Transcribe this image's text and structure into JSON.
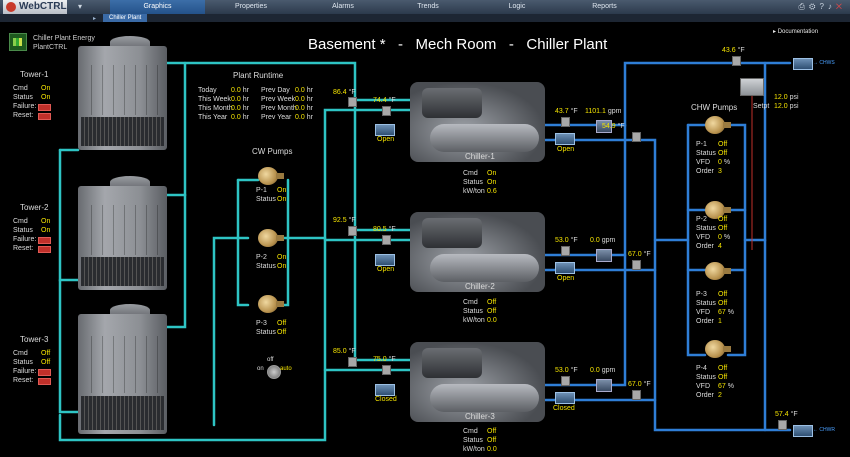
{
  "app": {
    "logo": "WebCTRL"
  },
  "nav": {
    "items": [
      {
        "label": "Graphics",
        "active": true
      },
      {
        "label": "Properties",
        "active": false
      },
      {
        "label": "Alarms",
        "active": false
      },
      {
        "label": "Trends",
        "active": false
      },
      {
        "label": "Logic",
        "active": false
      },
      {
        "label": "Reports",
        "active": false
      }
    ],
    "breadcrumb": "Chiller Plant"
  },
  "header": {
    "title": "Basement *   -   Mech Room   -   Chiller Plant",
    "documentation": "Documentation",
    "plant_energy": [
      "Chiller Plant Energy",
      "PlantCTRL"
    ]
  },
  "runtime": {
    "title": "Plant Runtime",
    "rows": [
      {
        "l1": "Today",
        "v1": "0.0",
        "l2": "Prev Day",
        "v2": "0.0"
      },
      {
        "l1": "This Week",
        "v1": "0.0",
        "l2": "Prev Week",
        "v2": "0.0"
      },
      {
        "l1": "This Month",
        "v1": "0.0",
        "l2": "Prev Month",
        "v2": "0.0"
      },
      {
        "l1": "This Year",
        "v1": "0.0",
        "l2": "Prev Year",
        "v2": "0.0"
      }
    ],
    "unit": "hr"
  },
  "towers": [
    {
      "name": "Tower-1",
      "cmd": "On",
      "status": "On"
    },
    {
      "name": "Tower-2",
      "cmd": "On",
      "status": "On"
    },
    {
      "name": "Tower-3",
      "cmd": "Off",
      "status": "Off"
    }
  ],
  "tower_labels": {
    "cmd": "Cmd",
    "status": "Status",
    "failure": "Failure:",
    "reset": "Reset:"
  },
  "cw_pumps": {
    "title": "CW Pumps",
    "items": [
      {
        "name": "P-1",
        "cmd": "On",
        "status": "On"
      },
      {
        "name": "P-2",
        "cmd": "On",
        "status": "On"
      },
      {
        "name": "P-3",
        "cmd": "Off",
        "status": "Off"
      }
    ]
  },
  "chillers": [
    {
      "name": "Chiller-1",
      "cmd": "On",
      "status": "On",
      "kwton": "0.6",
      "cw_ret": "86.4",
      "cw_sup": "74.4",
      "valve": "Open",
      "chw_ret": "43.7",
      "flow": "1101.1",
      "chw_sup": "54.9",
      "out_valve": "Open"
    },
    {
      "name": "Chiller-2",
      "cmd": "Off",
      "status": "Off",
      "kwton": "0.0",
      "cw_ret": "92.5",
      "cw_sup": "80.5",
      "valve": "Open",
      "chw_ret": "53.0",
      "flow": "0.0",
      "chw_sup": "67.0",
      "out_valve": "Open"
    },
    {
      "name": "Chiller-3",
      "cmd": "Off",
      "status": "Off",
      "kwton": "0.0",
      "cw_ret": "85.0",
      "cw_sup": "75.0",
      "valve": "Closed",
      "chw_ret": "53.0",
      "flow": "0.0",
      "chw_sup": "67.0",
      "out_valve": "Closed"
    }
  ],
  "chiller_labels": {
    "cmd": "Cmd",
    "status": "Status",
    "kwton": "kW/ton",
    "deg": "°F",
    "gpm": "gpm"
  },
  "chw_pumps": {
    "title": "CHW Pumps",
    "items": [
      {
        "name": "P-1",
        "cmd": "Off",
        "status": "Off",
        "vfd": "0",
        "order": "3"
      },
      {
        "name": "P-2",
        "cmd": "Off",
        "status": "Off",
        "vfd": "0",
        "order": "4"
      },
      {
        "name": "P-3",
        "cmd": "Off",
        "status": "Off",
        "vfd": "67",
        "order": "1"
      },
      {
        "name": "P-4",
        "cmd": "Off",
        "status": "Off",
        "vfd": "67",
        "order": "2"
      }
    ],
    "labels": {
      "vfd": "VFD",
      "order": "Order",
      "pct": "%"
    }
  },
  "system": {
    "supply_temp": "43.6",
    "return_temp": "57.4",
    "dp": "12.0",
    "dp_label": "psi",
    "setpt": "12.0",
    "setpt_label": "Setpt",
    "to_label": "→ CHWS",
    "from_label": "← CHWR"
  },
  "switch": {
    "off": "off",
    "on": "on",
    "auto": "auto"
  },
  "colors": {
    "cw": "#2ec4c4",
    "chw": "#2f7ed6",
    "value": "#f5e400",
    "alarm": "#c0302a"
  }
}
